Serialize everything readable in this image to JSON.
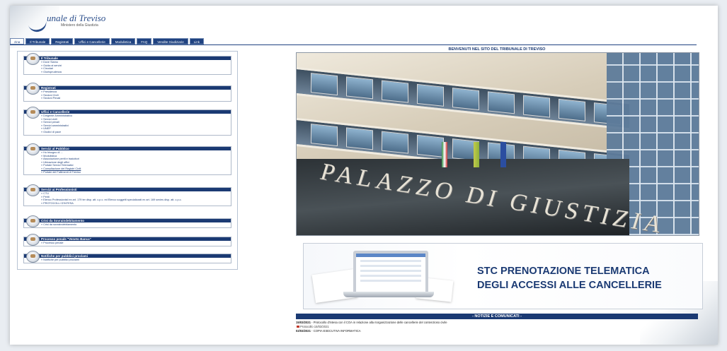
{
  "header": {
    "title": "unale di Treviso",
    "subtitle": "Ministero della Giustizia"
  },
  "tabs": [
    "zina",
    "Il Tribunale",
    "Registrati",
    "Uffici e Cancellerie",
    "Modulistica",
    "FAQ",
    "Vendite Giudiziarie",
    "Link"
  ],
  "sidebar": {
    "boxes": [
      {
        "title": "Il Tribunale",
        "items": [
          "Dove Siamo",
          "Guida ai servizi",
          "Circolari",
          "Giurisprudenza"
        ]
      },
      {
        "title": "Registrati",
        "items": [
          "Presidenza",
          "Sezioni Civili",
          "Sezioni Penali"
        ]
      },
      {
        "title": "Uffici e Cancellerie",
        "items": [
          "Dirigente Amministrativo",
          "Servizi civili",
          "Servizi penali",
          "Servizi amministrativi",
          "UNEP",
          "Giudici di pace"
        ]
      },
      {
        "title": "Servizi al Pubblico",
        "items": [
          "Ho bisogno di ...",
          "Modulistica",
          "Associazione periti e traduttori",
          "Ubicazione degli uffici",
          "Portale Servizi Telematici",
          "Consultazione dei Registri Civili",
          "Portale del Fallimenti di Treviso"
        ]
      },
      {
        "title": "Servizi ai Professionisti",
        "items": [
          "CTU",
          "Periti",
          "Elenco Professionisti ex art. 179 ter disp. att. c.p.c. ed Elenco soggetti specializzati ex art. 169 sexies disp. att. c.p.c.",
          "PROTOCOLLI D'INTESA"
        ]
      },
      {
        "title": "Crisi da Sovraindebitamento",
        "items": [
          "Crisi da sovraindebitamento"
        ]
      },
      {
        "title": "Processo penale \"Veneto Banca\"",
        "items": [
          "Processo penale"
        ]
      },
      {
        "title": "Notifiche per pubblici proclami",
        "items": [
          "Notifiche per pubblici proclami"
        ]
      }
    ]
  },
  "main": {
    "welcome": "BENVENUTI NEL SITO DEL TRIBUNALE DI TREVISO",
    "photo_text": "PALAZZO DI GIUSTIZIA",
    "banner": {
      "line1": "STC PRENOTAZIONE TELEMATICA",
      "line2": "DEGLI ACCESSI ALLE CANCELLERIE"
    },
    "news_header": "- NOTIZIE E COMUNICATI -",
    "news": [
      {
        "date": "15/03/2021",
        "text": "Protocollo d'intesa con il COA in relazione alla riorganizzazione delle cancellerie del contenzioso civile"
      },
      {
        "date": "",
        "text": "Protocollo 15/03/2021"
      },
      {
        "date": "02/03/2021",
        "text": "COPIA ESECUTIVA INFORMATICA"
      }
    ]
  },
  "colors": {
    "navy": "#1b3a73",
    "tab": "#1f4280"
  }
}
